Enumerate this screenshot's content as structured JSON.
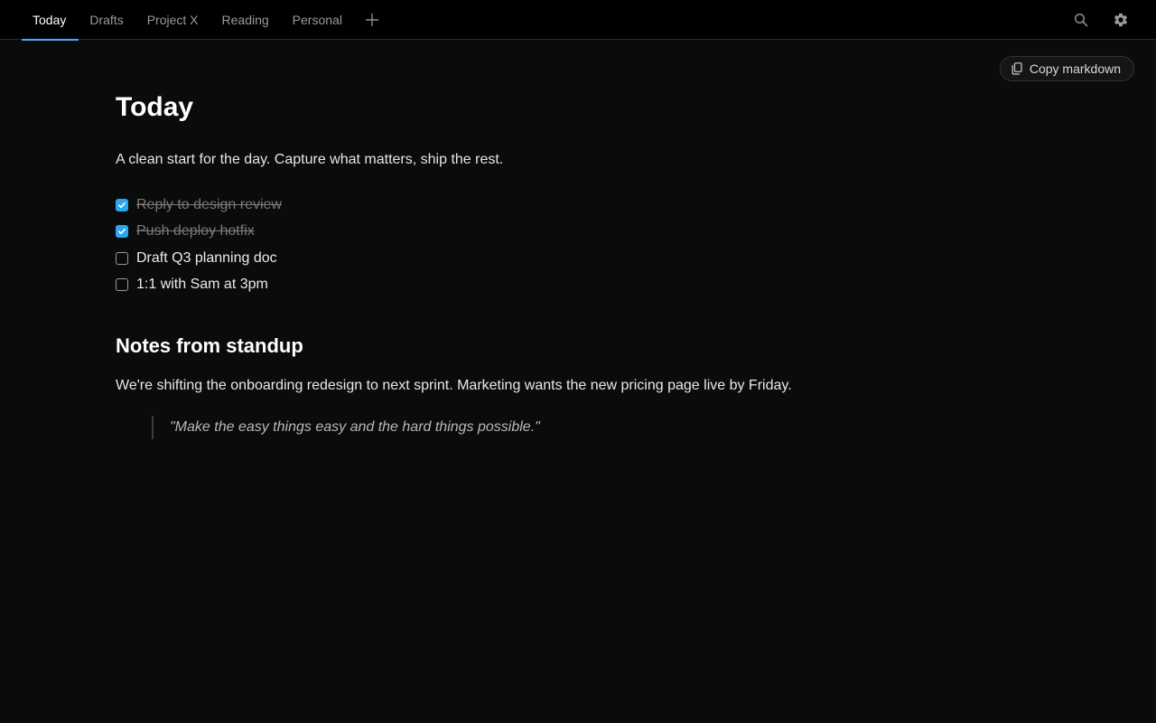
{
  "tabs": [
    {
      "label": "Today",
      "active": true
    },
    {
      "label": "Drafts",
      "active": false
    },
    {
      "label": "Project X",
      "active": false
    },
    {
      "label": "Reading",
      "active": false
    },
    {
      "label": "Personal",
      "active": false
    }
  ],
  "toolbar": {
    "add_tab_icon": "plus-icon",
    "search_icon": "search-icon",
    "settings_icon": "gear-icon",
    "copy_label": "Copy markdown",
    "copy_icon": "copy-icon"
  },
  "doc": {
    "title": "Today",
    "intro": "A clean start for the day. Capture what matters, ship the rest.",
    "tasks": [
      {
        "text": "Reply to design review",
        "done": true
      },
      {
        "text": "Push deploy hotfix",
        "done": true
      },
      {
        "text": "Draft Q3 planning doc",
        "done": false
      },
      {
        "text": "1:1 with Sam at 3pm",
        "done": false
      }
    ],
    "section_heading": "Notes from standup",
    "section_body": "We're shifting the onboarding redesign to next sprint. Marketing wants the new pricing page live by Friday.",
    "quote": "\"Make the easy things easy and the hard things possible.\""
  },
  "colors": {
    "background": "#0b0b0b",
    "topbar": "#000000",
    "accent": "#4aa8ff",
    "checkbox_checked": "#29a8f0"
  }
}
